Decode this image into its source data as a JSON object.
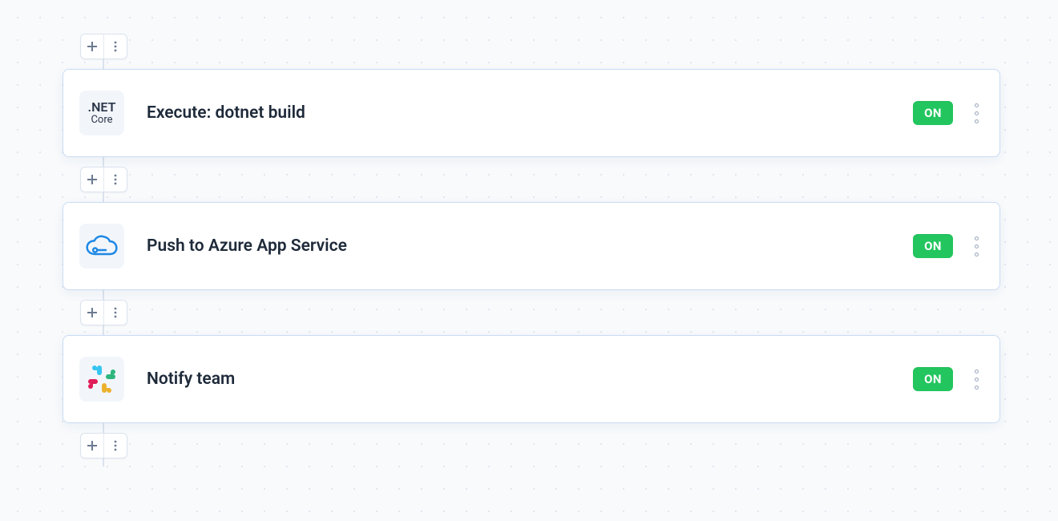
{
  "pipeline": {
    "steps": [
      {
        "icon": "dotnet-core",
        "title": "Execute: dotnet build",
        "toggle": "ON"
      },
      {
        "icon": "azure",
        "title": "Push to Azure App Service",
        "toggle": "ON"
      },
      {
        "icon": "slack",
        "title": "Notify team",
        "toggle": "ON"
      }
    ]
  },
  "colors": {
    "card_border": "#c9dcf4",
    "toggle_on_bg": "#22c55e",
    "connector": "#dbe3ee",
    "text": "#1e2a3a",
    "muted": "#6b7a90"
  }
}
